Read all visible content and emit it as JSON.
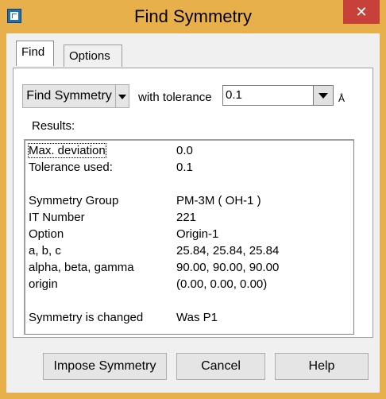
{
  "window": {
    "title": "Find Symmetry",
    "close_symbol": "✕",
    "icon": "app-icon"
  },
  "tabs": [
    {
      "label": "Find",
      "active": true
    },
    {
      "label": "Options",
      "active": false
    }
  ],
  "find": {
    "button_label": "Find Symmetry",
    "tolerance_label": "with tolerance",
    "tolerance_value": "0.1",
    "unit_label": "Å",
    "results_label": "Results:"
  },
  "results": [
    {
      "key": "Max. deviation",
      "value": "0.0"
    },
    {
      "key": "Tolerance used:",
      "value": "0.1"
    },
    {
      "key": "Symmetry Group",
      "value": "PM-3M  ( OH-1 )"
    },
    {
      "key": "IT Number",
      "value": "221"
    },
    {
      "key": "Option",
      "value": "Origin-1"
    },
    {
      "key": "a, b, c",
      "value": "25.84,  25.84,  25.84"
    },
    {
      "key": "alpha, beta, gamma",
      "value": "90.00,  90.00,  90.00"
    },
    {
      "key": "origin",
      "value": "(0.00,  0.00,  0.00)"
    },
    {
      "key": "Symmetry is changed",
      "value": "Was P1"
    }
  ],
  "buttons": {
    "impose": "Impose Symmetry",
    "cancel": "Cancel",
    "help": "Help"
  },
  "colors": {
    "titlebar": "#e8b04a",
    "close_button": "#c7413a",
    "dialog_background": "#f0f0f0"
  }
}
